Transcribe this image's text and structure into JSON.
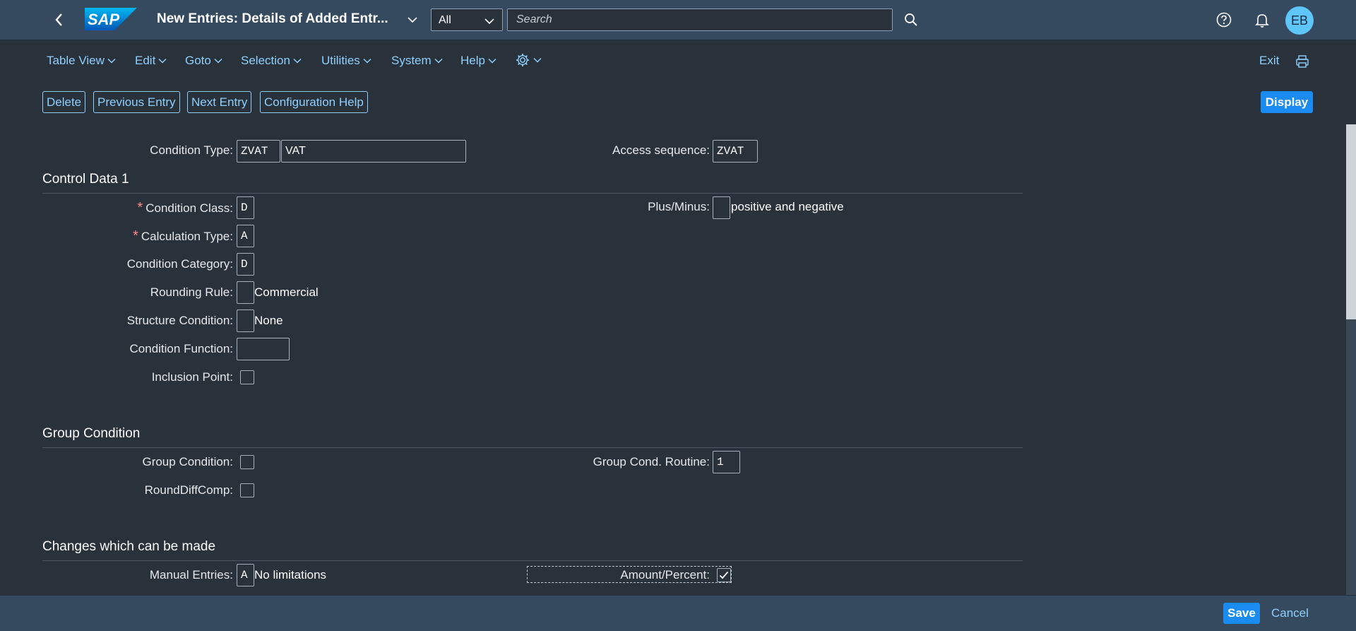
{
  "colors": {
    "shell": "#354a5f",
    "page": "#29313a",
    "link": "#8fcffd",
    "emphasized": "#1a8cf1",
    "avatar": "#5fc6fb"
  },
  "shell": {
    "logo": "SAP",
    "title": "New Entries: Details of Added Entr...",
    "scope": "All",
    "search_placeholder": "Search",
    "avatar_initials": "EB"
  },
  "menu": {
    "items": [
      "Table View",
      "Edit",
      "Goto",
      "Selection",
      "Utilities",
      "System",
      "Help"
    ],
    "exit": "Exit"
  },
  "toolbar": {
    "delete": "Delete",
    "previous": "Previous Entry",
    "next": "Next Entry",
    "config_help": "Configuration Help",
    "display": "Display"
  },
  "header": {
    "cond_type_label": "Condition Type:",
    "cond_type_value": "ZVAT",
    "cond_type_desc": "VAT",
    "access_seq_label": "Access sequence:",
    "access_seq_value": "ZVAT"
  },
  "control_data": {
    "title": "Control Data 1",
    "condition_class": {
      "label": "Condition Class:",
      "value": "D"
    },
    "calculation_type": {
      "label": "Calculation Type:",
      "value": "A"
    },
    "condition_category": {
      "label": "Condition Category:",
      "value": "D"
    },
    "rounding_rule": {
      "label": "Rounding Rule:",
      "value": "",
      "desc": "Commercial"
    },
    "structure_condition": {
      "label": "Structure Condition:",
      "value": "",
      "desc": "None"
    },
    "condition_function": {
      "label": "Condition Function:",
      "value": ""
    },
    "inclusion_point": {
      "label": "Inclusion Point:",
      "checked": false
    },
    "plus_minus": {
      "label": "Plus/Minus:",
      "value": "",
      "desc": "positive and negative"
    }
  },
  "group_condition": {
    "title": "Group Condition",
    "group_condition": {
      "label": "Group Condition:",
      "checked": false
    },
    "round_diff_comp": {
      "label": "RoundDiffComp:",
      "checked": false
    },
    "group_cond_routine": {
      "label": "Group Cond. Routine:",
      "value": "1"
    }
  },
  "changes": {
    "title": "Changes which can be made",
    "manual_entries": {
      "label": "Manual Entries:",
      "value": "A",
      "desc": "No limitations"
    },
    "amount_percent": {
      "label": "Amount/Percent:",
      "checked": true
    }
  },
  "footer": {
    "save": "Save",
    "cancel": "Cancel"
  }
}
